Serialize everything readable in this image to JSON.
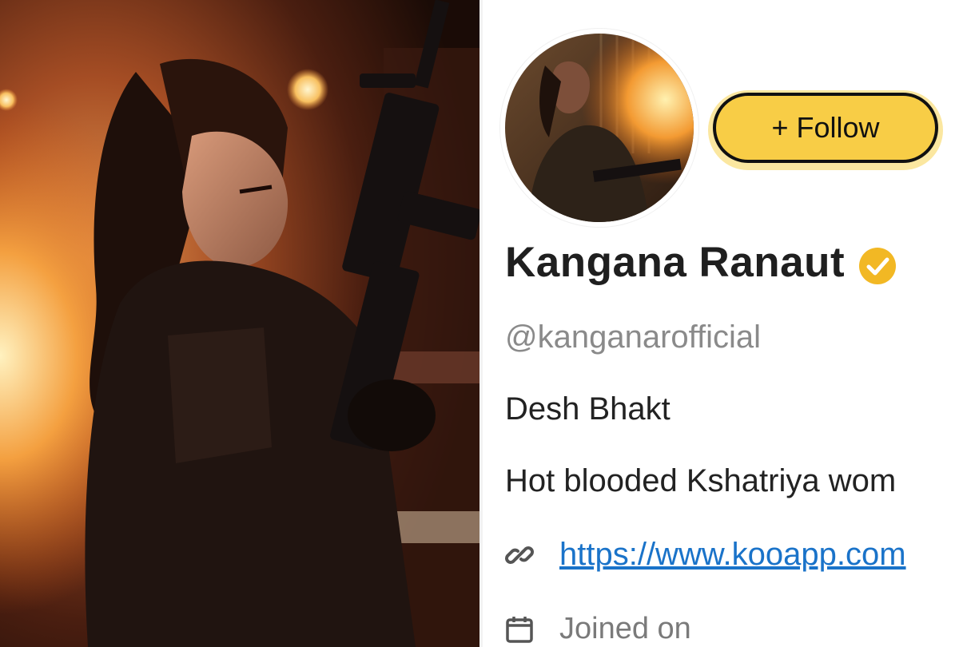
{
  "profile": {
    "follow_label": "+ Follow",
    "name": "Kangana Ranaut",
    "handle": "@kanganarofficial",
    "bio_line_1": "Desh Bhakt",
    "bio_line_2": "Hot blooded Kshatriya wom",
    "link": "https://www.kooapp.com",
    "joined_label": "Joined on"
  },
  "colors": {
    "follow_button_bg": "#f8cd46",
    "verified_badge": "#f2b824",
    "link": "#1a73c9",
    "handle_text": "#8a8a8a"
  },
  "icons": {
    "verified": "verified-check-icon",
    "link": "chain-link-icon",
    "calendar": "calendar-icon"
  }
}
